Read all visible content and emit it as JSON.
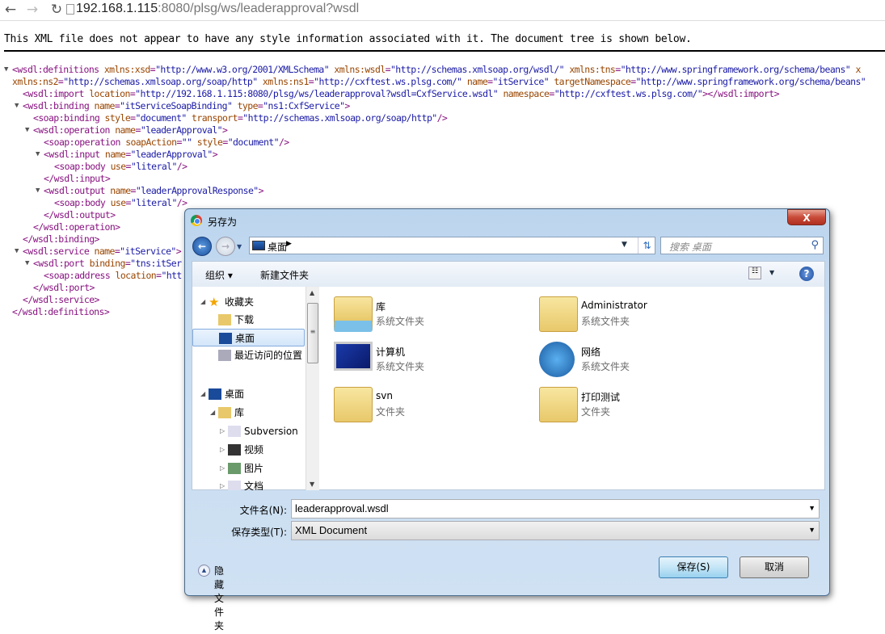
{
  "browser": {
    "url_host": "192.168.1.115",
    "url_rest": ":8080/plsg/ws/leaderapproval?wsdl",
    "back": "←",
    "forward": "→",
    "reload": "↻"
  },
  "notice": "This XML file does not appear to have any style information associated with it. The document tree is shown below.",
  "xml_lines": [
    {
      "level": 0,
      "toggle": true,
      "tokens": [
        [
          "tag",
          "<wsdl:definitions "
        ],
        [
          "attr",
          "xmlns:xsd"
        ],
        [
          "tag",
          "="
        ],
        [
          "val",
          "\"http://www.w3.org/2001/XMLSchema\" "
        ],
        [
          "attr",
          "xmlns:wsdl"
        ],
        [
          "tag",
          "="
        ],
        [
          "val",
          "\"http://schemas.xmlsoap.org/wsdl/\" "
        ],
        [
          "attr",
          "xmlns:tns"
        ],
        [
          "tag",
          "="
        ],
        [
          "val",
          "\"http://www.springframework.org/schema/beans\" "
        ],
        [
          "attr",
          "x"
        ]
      ]
    },
    {
      "level": 0,
      "toggle": false,
      "tokens": [
        [
          "attr",
          "xmlns:ns2"
        ],
        [
          "tag",
          "="
        ],
        [
          "val",
          "\"http://schemas.xmlsoap.org/soap/http\" "
        ],
        [
          "attr",
          "xmlns:ns1"
        ],
        [
          "tag",
          "="
        ],
        [
          "val",
          "\"http://cxftest.ws.plsg.com/\" "
        ],
        [
          "attr",
          "name"
        ],
        [
          "tag",
          "="
        ],
        [
          "val",
          "\"itService\" "
        ],
        [
          "attr",
          "targetNamespace"
        ],
        [
          "tag",
          "="
        ],
        [
          "val",
          "\"http://www.springframework.org/schema/beans\""
        ]
      ]
    },
    {
      "level": 1,
      "toggle": false,
      "tokens": [
        [
          "tag",
          "<wsdl:import "
        ],
        [
          "attr",
          "location"
        ],
        [
          "tag",
          "="
        ],
        [
          "val",
          "\"http://192.168.1.115:8080/plsg/ws/leaderapproval?wsdl=CxfService.wsdl\" "
        ],
        [
          "attr",
          "namespace"
        ],
        [
          "tag",
          "="
        ],
        [
          "val",
          "\"http://cxftest.ws.plsg.com/\""
        ],
        [
          "tag",
          "></wsdl:import>"
        ]
      ]
    },
    {
      "level": 1,
      "toggle": true,
      "tokens": [
        [
          "tag",
          "<wsdl:binding "
        ],
        [
          "attr",
          "name"
        ],
        [
          "tag",
          "="
        ],
        [
          "val",
          "\"itServiceSoapBinding\" "
        ],
        [
          "attr",
          "type"
        ],
        [
          "tag",
          "="
        ],
        [
          "val",
          "\"ns1:CxfService\""
        ],
        [
          "tag",
          ">"
        ]
      ]
    },
    {
      "level": 2,
      "toggle": false,
      "tokens": [
        [
          "tag",
          "<soap:binding "
        ],
        [
          "attr",
          "style"
        ],
        [
          "tag",
          "="
        ],
        [
          "val",
          "\"document\" "
        ],
        [
          "attr",
          "transport"
        ],
        [
          "tag",
          "="
        ],
        [
          "val",
          "\"http://schemas.xmlsoap.org/soap/http\""
        ],
        [
          "tag",
          "/>"
        ]
      ]
    },
    {
      "level": 2,
      "toggle": true,
      "tokens": [
        [
          "tag",
          "<wsdl:operation "
        ],
        [
          "attr",
          "name"
        ],
        [
          "tag",
          "="
        ],
        [
          "val",
          "\"leaderApproval\""
        ],
        [
          "tag",
          ">"
        ]
      ]
    },
    {
      "level": 3,
      "toggle": false,
      "tokens": [
        [
          "tag",
          "<soap:operation "
        ],
        [
          "attr",
          "soapAction"
        ],
        [
          "tag",
          "="
        ],
        [
          "val",
          "\"\" "
        ],
        [
          "attr",
          "style"
        ],
        [
          "tag",
          "="
        ],
        [
          "val",
          "\"document\""
        ],
        [
          "tag",
          "/>"
        ]
      ]
    },
    {
      "level": 3,
      "toggle": true,
      "tokens": [
        [
          "tag",
          "<wsdl:input "
        ],
        [
          "attr",
          "name"
        ],
        [
          "tag",
          "="
        ],
        [
          "val",
          "\"leaderApproval\""
        ],
        [
          "tag",
          ">"
        ]
      ]
    },
    {
      "level": 4,
      "toggle": false,
      "tokens": [
        [
          "tag",
          "<soap:body "
        ],
        [
          "attr",
          "use"
        ],
        [
          "tag",
          "="
        ],
        [
          "val",
          "\"literal\""
        ],
        [
          "tag",
          "/>"
        ]
      ]
    },
    {
      "level": 3,
      "toggle": false,
      "tokens": [
        [
          "tag",
          "</wsdl:input>"
        ]
      ]
    },
    {
      "level": 3,
      "toggle": true,
      "tokens": [
        [
          "tag",
          "<wsdl:output "
        ],
        [
          "attr",
          "name"
        ],
        [
          "tag",
          "="
        ],
        [
          "val",
          "\"leaderApprovalResponse\""
        ],
        [
          "tag",
          ">"
        ]
      ]
    },
    {
      "level": 4,
      "toggle": false,
      "tokens": [
        [
          "tag",
          "<soap:body "
        ],
        [
          "attr",
          "use"
        ],
        [
          "tag",
          "="
        ],
        [
          "val",
          "\"literal\""
        ],
        [
          "tag",
          "/>"
        ]
      ]
    },
    {
      "level": 3,
      "toggle": false,
      "tokens": [
        [
          "tag",
          "</wsdl:output>"
        ]
      ]
    },
    {
      "level": 2,
      "toggle": false,
      "tokens": [
        [
          "tag",
          "</wsdl:operation>"
        ]
      ]
    },
    {
      "level": 1,
      "toggle": false,
      "tokens": [
        [
          "tag",
          "</wsdl:binding>"
        ]
      ]
    },
    {
      "level": 1,
      "toggle": true,
      "tokens": [
        [
          "tag",
          "<wsdl:service "
        ],
        [
          "attr",
          "name"
        ],
        [
          "tag",
          "="
        ],
        [
          "val",
          "\"itService\""
        ],
        [
          "tag",
          ">"
        ]
      ]
    },
    {
      "level": 2,
      "toggle": true,
      "tokens": [
        [
          "tag",
          "<wsdl:port "
        ],
        [
          "attr",
          "binding"
        ],
        [
          "tag",
          "="
        ],
        [
          "val",
          "\"tns:itSer"
        ]
      ]
    },
    {
      "level": 3,
      "toggle": false,
      "tokens": [
        [
          "tag",
          "<soap:address "
        ],
        [
          "attr",
          "location"
        ],
        [
          "tag",
          "="
        ],
        [
          "val",
          "\"htt"
        ]
      ]
    },
    {
      "level": 2,
      "toggle": false,
      "tokens": [
        [
          "tag",
          "</wsdl:port>"
        ]
      ]
    },
    {
      "level": 1,
      "toggle": false,
      "tokens": [
        [
          "tag",
          "</wsdl:service>"
        ]
      ]
    },
    {
      "level": 0,
      "toggle": false,
      "tokens": [
        [
          "tag",
          "</wsdl:definitions>"
        ]
      ]
    }
  ],
  "dialog": {
    "title": "另存为",
    "close": "X",
    "address": "桌面",
    "search_placeholder": "搜索 桌面",
    "toolbar": {
      "organize": "组织 ▾",
      "new_folder": "新建文件夹"
    },
    "nav": [
      {
        "label": "收藏夹",
        "icon": "star-icon",
        "expander": "◢"
      },
      {
        "label": "下载",
        "icon": "downloads-icon"
      },
      {
        "label": "桌面",
        "icon": "desktop-icon",
        "selected": true
      },
      {
        "label": "最近访问的位置",
        "icon": "recent-places-icon"
      },
      {
        "label": "桌面",
        "icon": "desktop-icon",
        "expander": "◢"
      },
      {
        "label": "库",
        "icon": "library-icon",
        "expander": "◢"
      },
      {
        "label": "Subversion",
        "icon": "document-icon",
        "expander": "▷"
      },
      {
        "label": "视频",
        "icon": "video-icon",
        "expander": "▷"
      },
      {
        "label": "图片",
        "icon": "pictures-icon",
        "expander": "▷"
      },
      {
        "label": "文档",
        "icon": "document-icon",
        "expander": "▷"
      }
    ],
    "items": [
      {
        "name": "库",
        "type": "系统文件夹",
        "icon": "library-icon"
      },
      {
        "name": "Administrator",
        "type": "系统文件夹",
        "icon": "user-folder-icon"
      },
      {
        "name": "计算机",
        "type": "系统文件夹",
        "icon": "computer-icon"
      },
      {
        "name": "网络",
        "type": "系统文件夹",
        "icon": "network-icon"
      },
      {
        "name": "svn",
        "type": "文件夹",
        "icon": "folder-icon"
      },
      {
        "name": "打印测试",
        "type": "文件夹",
        "icon": "folder-icon"
      }
    ],
    "filename_label": "文件名(N):",
    "filename": "leaderapproval.wsdl",
    "filetype_label": "保存类型(T):",
    "filetype": "XML Document",
    "hide_folders": "隐藏文件夹",
    "save": "保存(S)",
    "cancel": "取消"
  }
}
